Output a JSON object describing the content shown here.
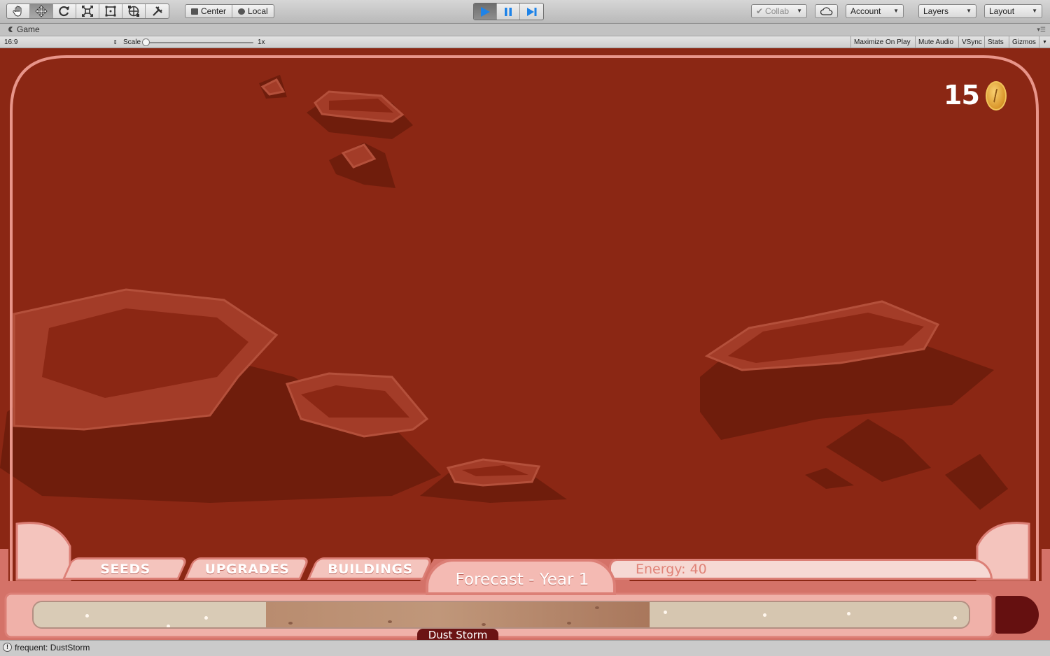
{
  "toolbar": {
    "tools": [
      {
        "icon": "hand-icon"
      },
      {
        "icon": "move-icon"
      },
      {
        "icon": "rotate-icon"
      },
      {
        "icon": "scale-icon"
      },
      {
        "icon": "rect-transform-icon"
      },
      {
        "icon": "transform-icon"
      },
      {
        "icon": "custom-tool-icon"
      }
    ],
    "pivot_label": "Center",
    "space_label": "Local",
    "collab_label": "Collab",
    "account_label": "Account",
    "layers_label": "Layers",
    "layout_label": "Layout"
  },
  "tab": {
    "title": "Game"
  },
  "gamebar": {
    "aspect": "16:9",
    "scale_label": "Scale",
    "scale_value": "1x",
    "maximize": "Maximize On Play",
    "mute": "Mute Audio",
    "vsync": "VSync",
    "stats": "Stats",
    "gizmos": "Gizmos"
  },
  "game": {
    "coins": "15",
    "tabs": {
      "seeds": "SEEDS",
      "upgrades": "UPGRADES",
      "buildings": "BUILDINGS"
    },
    "forecast": "Forecast - Year 1",
    "energy": "Energy: 40",
    "event": "Dust Storm"
  },
  "status": {
    "message": "frequent: DustStorm"
  },
  "colors": {
    "sky": "#8b2714",
    "frame": "#e8958a",
    "event_bg": "#6b1414"
  }
}
